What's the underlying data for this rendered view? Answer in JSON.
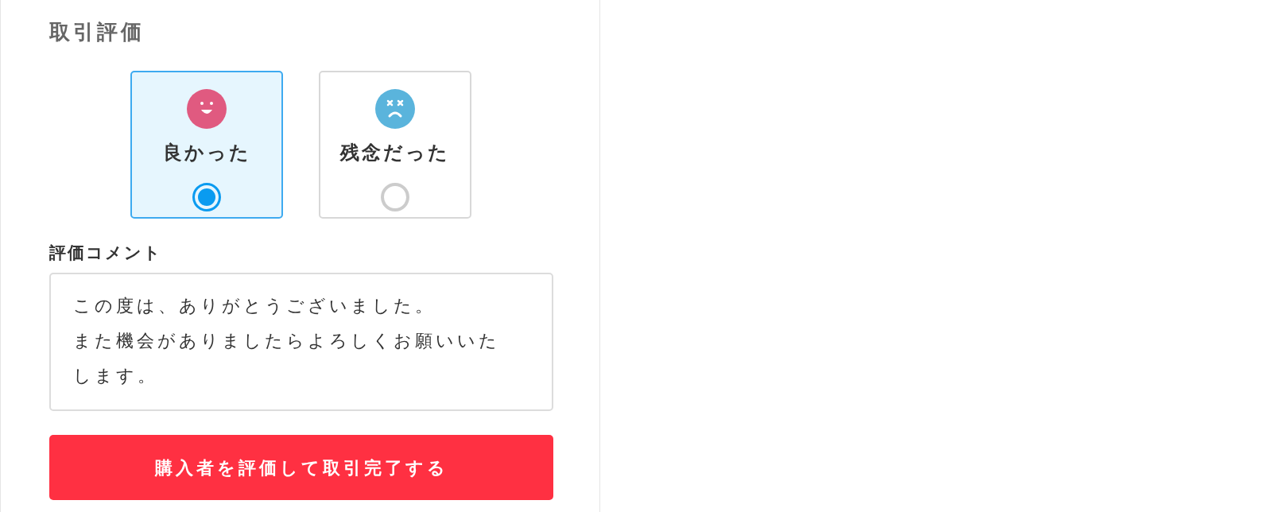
{
  "heading": "取引評価",
  "ratings": [
    {
      "label": "良かった",
      "kind": "good",
      "selected": true
    },
    {
      "label": "残念だった",
      "kind": "bad",
      "selected": false
    }
  ],
  "comment": {
    "label": "評価コメント",
    "paragraphs": [
      "この度は、ありがとうございました。",
      "また機会がありましたらよろしくお願いいたします。"
    ]
  },
  "submit_button": "購入者を評価して取引完了する"
}
